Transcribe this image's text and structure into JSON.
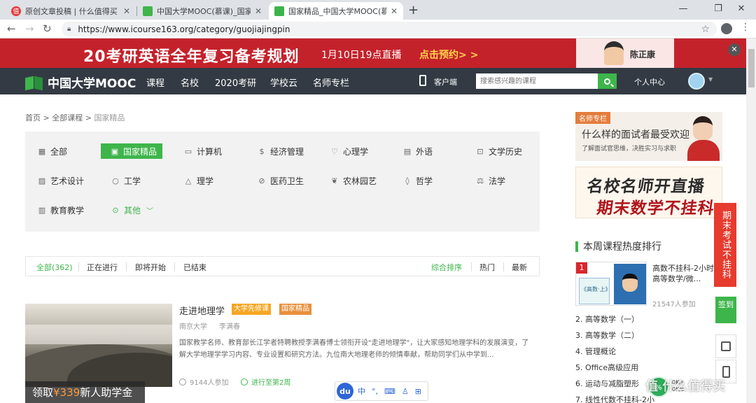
{
  "browser": {
    "tabs": [
      {
        "title": "原创文章投稿 | 什么值得买",
        "favicon": "smzdm-icon"
      },
      {
        "title": "中国大学MOOC(慕课)_国家精品",
        "favicon": "mooc-icon"
      },
      {
        "title": "国家精品_中国大学MOOC(慕课)",
        "favicon": "mooc-icon"
      }
    ],
    "active_tab": 2,
    "url": "https://www.icourse163.org/category/guojiajingpin"
  },
  "banner": {
    "headline": "20考研英语全年复习备考规划",
    "time": "1月10日19点直播",
    "cta": "点击预约> >",
    "teacher": "陈正康"
  },
  "sitenav": {
    "logo": "中国大学MOOC",
    "items": [
      "课程",
      "名校",
      "2020考研",
      "学校云",
      "名师专栏"
    ],
    "client": "客户端",
    "search_placeholder": "搜索感兴趣的课程",
    "user_center": "个人中心"
  },
  "breadcrumb": {
    "home": "首页",
    "all": "全部课程",
    "current": "国家精品",
    "sep": ">"
  },
  "categories": [
    {
      "label": "全部",
      "icon": "grid-icon"
    },
    {
      "label": "国家精品",
      "icon": "award-icon"
    },
    {
      "label": "计算机",
      "icon": "monitor-icon"
    },
    {
      "label": "经济管理",
      "icon": "money-icon"
    },
    {
      "label": "心理学",
      "icon": "heart-icon"
    },
    {
      "label": "外语",
      "icon": "chat-icon"
    },
    {
      "label": "文学历史",
      "icon": "book-icon"
    },
    {
      "label": "艺术设计",
      "icon": "image-icon"
    },
    {
      "label": "工学",
      "icon": "bulb-icon"
    },
    {
      "label": "理学",
      "icon": "flask-icon"
    },
    {
      "label": "医药卫生",
      "icon": "pill-icon"
    },
    {
      "label": "农林园艺",
      "icon": "leaf-icon"
    },
    {
      "label": "哲学",
      "icon": "pin-icon"
    },
    {
      "label": "法学",
      "icon": "scale-icon"
    },
    {
      "label": "教育教学",
      "icon": "edu-icon"
    },
    {
      "label": "其他",
      "icon": "more-icon"
    }
  ],
  "filters": {
    "status": [
      "全部(362)",
      "正在进行",
      "即将开始",
      "已结束"
    ],
    "sort": [
      "综合排序",
      "热门",
      "最新"
    ]
  },
  "course": {
    "title": "走进地理学",
    "tags": [
      "大学先修课",
      "国家精品"
    ],
    "school": "南京大学",
    "teacher": "李满春",
    "desc": "国家教学名师、教育部长江学者特聘教授李满春博士领衔开设\"走进地理学\"，让大家感知地理学科的发展演变，了解大学地理学学习内容、专业设置和研究方法。九位南大地理老师的倾情奉献，帮助同学们从中学到...",
    "enrolled": "9144人参加",
    "progress": "进行至第2周"
  },
  "scholarship": {
    "pre": "领取",
    "amount": "¥339",
    "post": "新人助学金"
  },
  "ime": {
    "logo": "du",
    "items": [
      "中",
      "°,",
      "⌨",
      "♙",
      "⊞"
    ]
  },
  "sidebar": {
    "ad1": {
      "label": "名师专栏",
      "question": "什么样的面试者最受欢迎",
      "sub": "了解面试官思维，决胜实习与求职"
    },
    "ad2": {
      "line1": "名校名师开直播",
      "line2": "期末数学不挂科"
    },
    "rank_title": "本周课程热度排行",
    "rank1": {
      "num": "1",
      "title": "高数不挂科-2小时学完高等数学/微...",
      "count": "21547人参加",
      "book": "《高数·上》"
    },
    "ranks": [
      "2. 高等数学（一）",
      "3. 高等数学（二）",
      "4. 管理概论",
      "5. Office高级应用",
      "6. 运动与减脂塑形",
      "7. 线性代数不挂科-2小"
    ]
  },
  "floating": {
    "vertical": "期末考试不挂科",
    "signin": "签到"
  },
  "speed": {
    "value": "0K/s",
    "up": "0K/s"
  },
  "watermark": "值 什么值得买"
}
